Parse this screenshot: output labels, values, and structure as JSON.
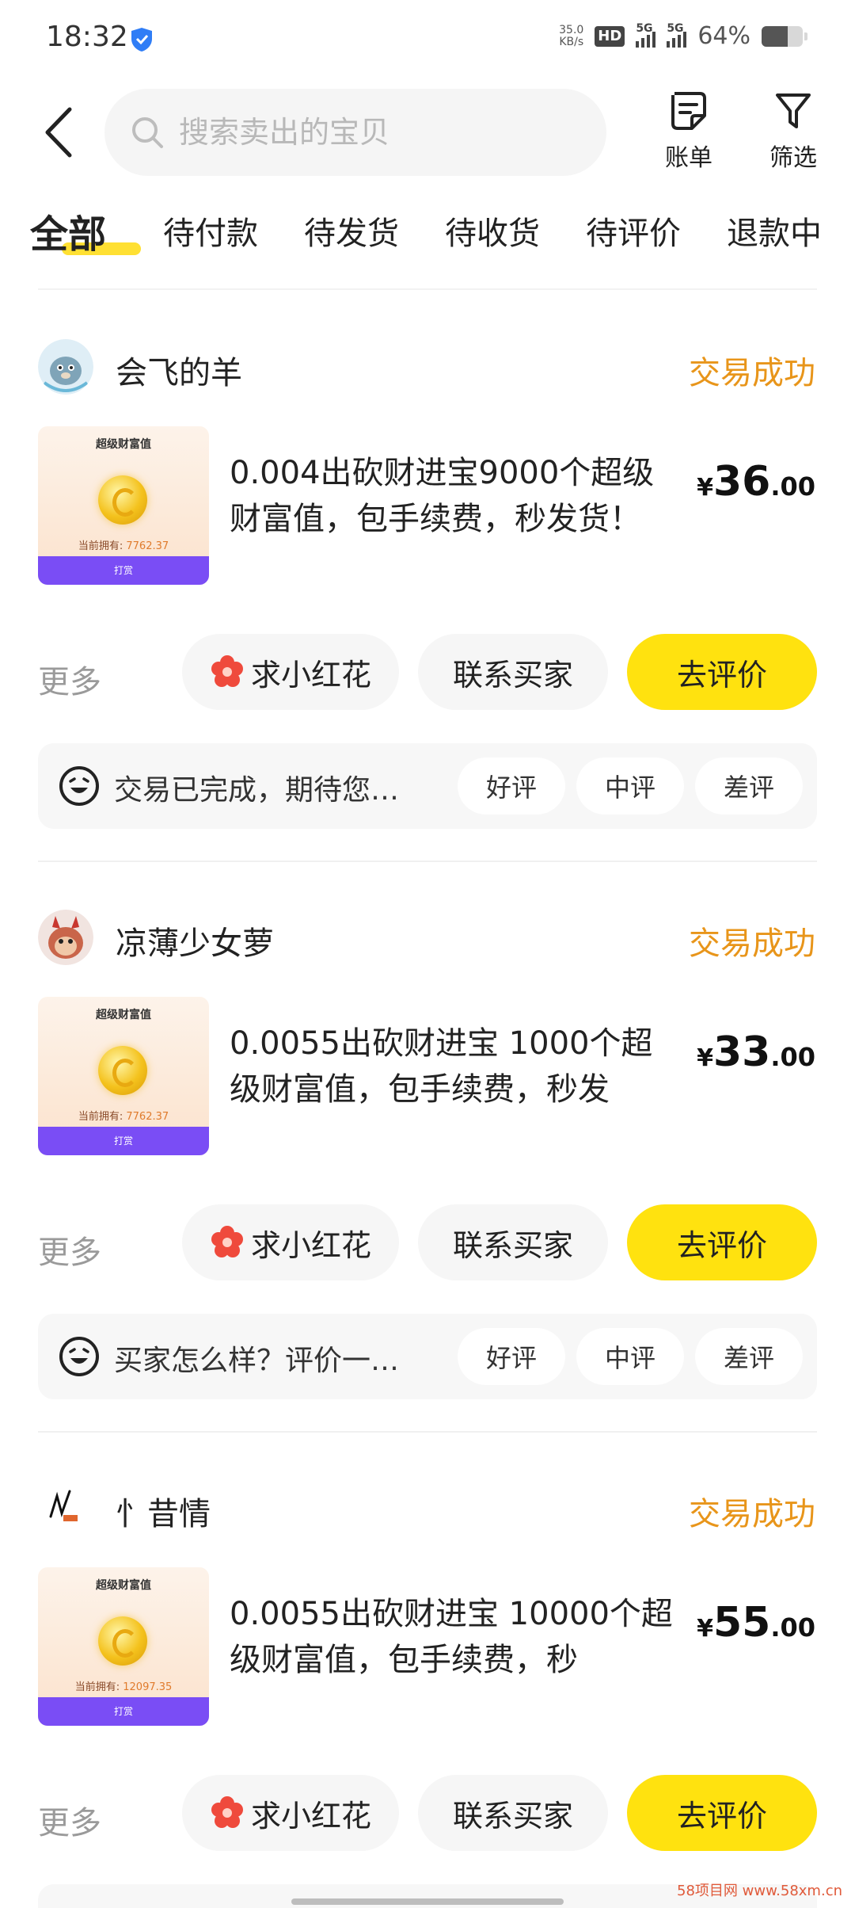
{
  "status_bar": {
    "time": "18:32",
    "net_speed_value": "35.0",
    "net_speed_unit": "KB/s",
    "hd_label": "HD",
    "signal1_label": "5G",
    "signal2_label": "5G",
    "battery_percent": "64%",
    "battery_level": 0.64
  },
  "header": {
    "search_placeholder": "搜索卖出的宝贝",
    "bill_label": "账单",
    "filter_label": "筛选"
  },
  "tabs": [
    {
      "label": "全部",
      "active": true
    },
    {
      "label": "待付款"
    },
    {
      "label": "待发货"
    },
    {
      "label": "待收货"
    },
    {
      "label": "待评价"
    },
    {
      "label": "退款中"
    }
  ],
  "orders": [
    {
      "seller": "会飞的羊",
      "status": "交易成功",
      "thumb": {
        "title": "超级财富值",
        "own_label": "当前拥有:",
        "own_value": "7762.37",
        "bar_label": "打赏"
      },
      "title": "0.004出砍财进宝9000个超级财富值，包手续费，秒发货！",
      "price_currency": "¥",
      "price_int": "36",
      "price_dec": ".00",
      "more": "更多",
      "flower_btn": "求小红花",
      "contact_btn": "联系买家",
      "review_btn": "去评价",
      "feedback_text": "交易已完成，期待您…",
      "good": "好评",
      "mid": "中评",
      "bad": "差评"
    },
    {
      "seller": "凉薄少女萝",
      "status": "交易成功",
      "thumb": {
        "title": "超级财富值",
        "own_label": "当前拥有:",
        "own_value": "7762.37",
        "bar_label": "打赏"
      },
      "title": "0.0055出砍财进宝 1000个超级财富值，包手续费，秒发",
      "price_currency": "¥",
      "price_int": "33",
      "price_dec": ".00",
      "more": "更多",
      "flower_btn": "求小红花",
      "contact_btn": "联系买家",
      "review_btn": "去评价",
      "feedback_text": "买家怎么样？评价一…",
      "good": "好评",
      "mid": "中评",
      "bad": "差评"
    },
    {
      "seller": "忄昔情",
      "status": "交易成功",
      "thumb": {
        "title": "超级财富值",
        "own_label": "当前拥有:",
        "own_value": "12097.35",
        "bar_label": "打赏"
      },
      "title": "0.0055出砍财进宝 10000个超级财富值，包手续费，秒",
      "price_currency": "¥",
      "price_int": "55",
      "price_dec": ".00",
      "more": "更多",
      "flower_btn": "求小红花",
      "contact_btn": "联系买家",
      "review_btn": "去评价"
    }
  ],
  "watermark": "58项目网 www.58xm.cn",
  "colors": {
    "accent_yellow": "#ffe20f",
    "status_orange": "#e8951a",
    "tab_highlight": "#ffe033"
  }
}
